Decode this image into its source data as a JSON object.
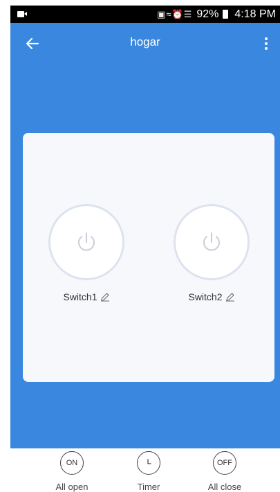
{
  "status_bar": {
    "battery": "92%",
    "time": "4:18 PM",
    "icons": [
      "video-icon",
      "cast-icon",
      "mute-icon",
      "alarm-icon",
      "wifi-icon",
      "signal-icon",
      "battery-icon"
    ]
  },
  "header": {
    "title": "hogar"
  },
  "switches": [
    {
      "label": "Switch1"
    },
    {
      "label": "Switch2"
    }
  ],
  "bottom_actions": [
    {
      "icon_text": "ON",
      "label": "All open"
    },
    {
      "icon_text": "",
      "label": "Timer"
    },
    {
      "icon_text": "OFF",
      "label": "All close"
    }
  ],
  "colors": {
    "primary": "#3a87e0",
    "card": "#f7f8fc"
  }
}
